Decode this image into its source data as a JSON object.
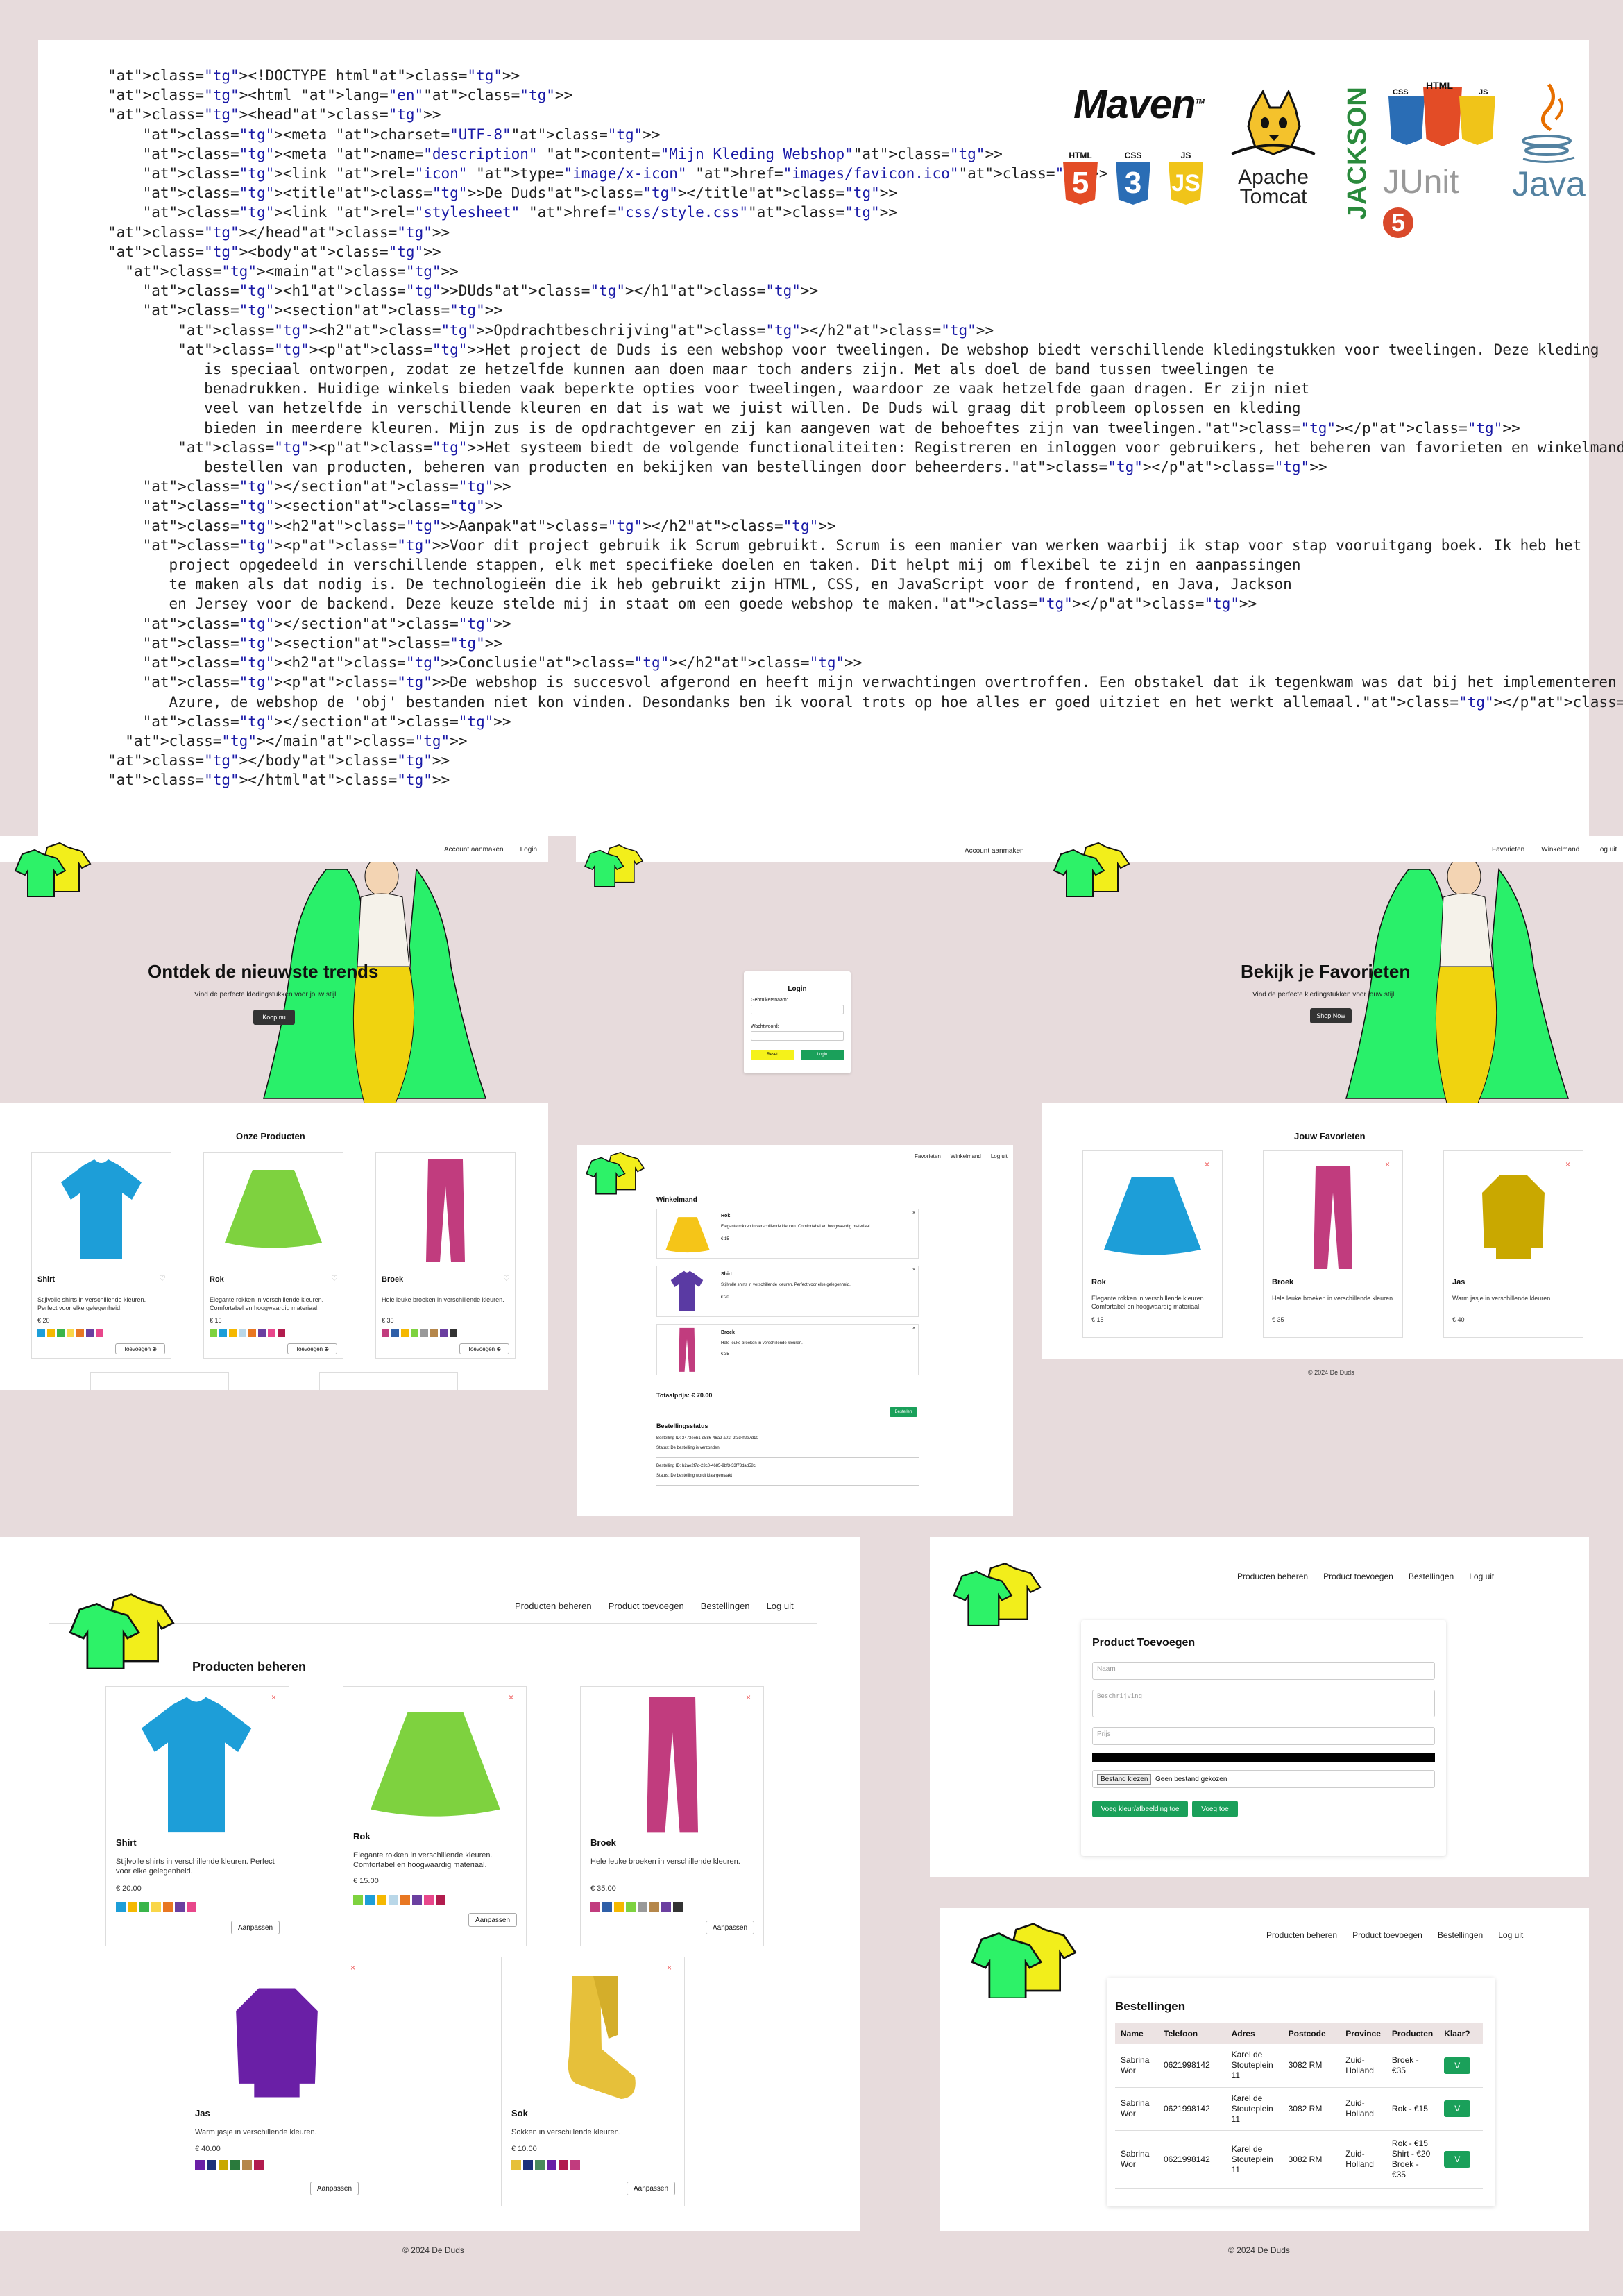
{
  "code": {
    "lines": [
      "<!DOCTYPE html>",
      "<html lang=\"en\">",
      "<head>",
      "    <meta charset=\"UTF-8\">",
      "    <meta name=\"description\" content=\"Mijn Kleding Webshop\">",
      "    <link rel=\"icon\" type=\"image/x-icon\" href=\"images/favicon.ico\">",
      "    <title>De Duds</title>",
      "    <link rel=\"stylesheet\" href=\"css/style.css\">",
      "</head>",
      "<body>",
      "  <main>",
      "    <h1>DUds</h1>",
      "    <section>",
      "        <h2>Opdrachtbeschrijving</h2>",
      "        <p>Het project de Duds is een webshop voor tweelingen. De webshop biedt verschillende kledingstukken voor tweelingen. Deze kleding",
      "           is speciaal ontworpen, zodat ze hetzelfde kunnen aan doen maar toch anders zijn. Met als doel de band tussen tweelingen te",
      "           benadrukken. Huidige winkels bieden vaak beperkte opties voor tweelingen, waardoor ze vaak hetzelfde gaan dragen. Er zijn niet",
      "           veel van hetzelfde in verschillende kleuren en dat is wat we juist willen. De Duds wil graag dit probleem oplossen en kleding",
      "           bieden in meerdere kleuren. Mijn zus is de opdrachtgever en zij kan aangeven wat de behoeftes zijn van tweelingen.</p>",
      "        <p>Het systeem biedt de volgende functionaliteiten: Registreren en inloggen voor gebruikers, het beheren van favorieten en winkelmand,",
      "           bestellen van producten, beheren van producten en bekijken van bestellingen door beheerders.</p>",
      "    </section>",
      "    <section>",
      "    <h2>Aanpak</h2>",
      "    <p>Voor dit project gebruik ik Scrum gebruikt. Scrum is een manier van werken waarbij ik stap voor stap vooruitgang boek. Ik heb het",
      "       project opgedeeld in verschillende stappen, elk met specifieke doelen en taken. Dit helpt mij om flexibel te zijn en aanpassingen",
      "       te maken als dat nodig is. De technologieën die ik heb gebruikt zijn HTML, CSS, en JavaScript voor de frontend, en Java, Jackson",
      "       en Jersey voor de backend. Deze keuze stelde mij in staat om een goede webshop te maken.</p>",
      "    </section>",
      "    <section>",
      "    <h2>Conclusie</h2>",
      "    <p>De webshop is succesvol afgerond en heeft mijn verwachtingen overtroffen. Een obstakel dat ik tegenkwam was dat bij het implementeren op",
      "       Azure, de webshop de 'obj' bestanden niet kon vinden. Desondanks ben ik vooral trots op hoe alles er goed uitziet en het werkt allemaal.</p>",
      "    </section>",
      "  </main>",
      "</body>",
      "</html>"
    ]
  },
  "logos": {
    "maven": "Maven",
    "maven_tm": "TM",
    "tomcat_line1": "Apache",
    "tomcat_line2": "Tomcat",
    "jackson": "JACKSON",
    "junit": "JUnit",
    "junit_num": "5",
    "java": "Java",
    "html": "HTML",
    "css": "CSS",
    "js": "JS",
    "html_num": "5",
    "css_num": "3",
    "js_num": "JS"
  },
  "shop_home": {
    "nav": [
      "Account aanmaken",
      "Login"
    ],
    "hero_title": "Ontdek de nieuwste trends",
    "hero_sub": "Vind de perfecte kledingstukken voor jouw stijl",
    "hero_button": "Koop nu",
    "products_title": "Onze Producten",
    "products": [
      {
        "name": "Shirt",
        "desc": "Stijlvolle shirts in verschillende kleuren. Perfect voor elke gelegenheid.",
        "price": "€ 20",
        "button": "Toevoegen"
      },
      {
        "name": "Rok",
        "desc": "Elegante rokken in verschillende kleuren. Comfortabel en hoogwaardig materiaal.",
        "price": "€ 15",
        "button": "Toevoegen"
      },
      {
        "name": "Broek",
        "desc": "Hele leuke broeken in verschillende kleuren.",
        "price": "€ 35",
        "button": "Toevoegen"
      }
    ]
  },
  "login": {
    "nav": [
      "Account aanmaken"
    ],
    "title": "Login",
    "user_label": "Gebruikersnaam:",
    "pass_label": "Wachtwoord:",
    "reset": "Reset",
    "submit": "Login"
  },
  "favorites_page": {
    "nav": [
      "Favorieten",
      "Winkelmand",
      "Log uit"
    ],
    "hero_title": "Bekijk je Favorieten",
    "hero_sub": "Vind de perfecte kledingstukken voor jouw stijl",
    "hero_button": "Shop Now",
    "section_title": "Jouw Favorieten",
    "items": [
      {
        "name": "Rok",
        "desc": "Elegante rokken in verschillende kleuren. Comfortabel en hoogwaardig materiaal.",
        "price": "€ 15"
      },
      {
        "name": "Broek",
        "desc": "Hele leuke broeken in verschillende kleuren.",
        "price": "€ 35"
      },
      {
        "name": "Jas",
        "desc": "Warm jasje in verschillende kleuren.",
        "price": "€ 40"
      }
    ],
    "footer": "© 2024 De Duds"
  },
  "cart": {
    "nav": [
      "Favorieten",
      "Winkelmand",
      "Log uit"
    ],
    "title": "Winkelmand",
    "items": [
      {
        "name": "Rok",
        "desc": "Elegante rokken in verschillende kleuren. Comfortabel en hoogwaardig materiaal.",
        "price": "€ 15"
      },
      {
        "name": "Shirt",
        "desc": "Stijlvolle shirts in verschillende kleuren. Perfect voor elke gelegenheid.",
        "price": "€ 20"
      },
      {
        "name": "Broek",
        "desc": "Hele leuke broeken in verschillende kleuren.",
        "price": "€ 35"
      }
    ],
    "total": "Totaalprijs: € 70.00",
    "order_button": "Bestellen",
    "status_title": "Bestellingsstatus",
    "orders": [
      {
        "id": "Bestelling ID: 2473eeb1-d586-46a2-a01f-2f3d4f2e7d10",
        "status": "Status: De bestelling is verzonden"
      },
      {
        "id": "Bestelling ID: b2ae2f7d-23c0-4685-9bf3-33f73dad58c",
        "status": "Status: De bestelling wordt klaargemaakt"
      }
    ]
  },
  "admin_products": {
    "nav": [
      "Producten beheren",
      "Product toevoegen",
      "Bestellingen",
      "Log uit"
    ],
    "title": "Producten beheren",
    "products": [
      {
        "name": "Shirt",
        "desc": "Stijlvolle shirts in verschillende kleuren. Perfect voor elke gelegenheid.",
        "price": "€ 20.00"
      },
      {
        "name": "Rok",
        "desc": "Elegante rokken in verschillende kleuren. Comfortabel en hoogwaardig materiaal.",
        "price": "€ 15.00"
      },
      {
        "name": "Broek",
        "desc": "Hele leuke broeken in verschillende kleuren.",
        "price": "€ 35.00"
      },
      {
        "name": "Jas",
        "desc": "Warm jasje in verschillende kleuren.",
        "price": "€ 40.00"
      },
      {
        "name": "Sok",
        "desc": "Sokken in verschillende kleuren.",
        "price": "€ 10.00"
      }
    ],
    "edit_button": "Aanpassen",
    "footer": "© 2024 De Duds"
  },
  "admin_add": {
    "nav": [
      "Producten beheren",
      "Product toevoegen",
      "Bestellingen",
      "Log uit"
    ],
    "title": "Product Toevoegen",
    "name_ph": "Naam",
    "desc_ph": "Beschrijving",
    "price_ph": "Prijs",
    "file_button": "Bestand kiezen",
    "file_text": "Geen bestand gekozen",
    "add_color": "Voeg kleur/afbeelding toe",
    "add": "Voeg toe"
  },
  "admin_orders": {
    "nav": [
      "Producten beheren",
      "Product toevoegen",
      "Bestellingen",
      "Log uit"
    ],
    "title": "Bestellingen",
    "headers": [
      "Name",
      "Telefoon",
      "Adres",
      "Postcode",
      "Province",
      "Producten",
      "Klaar?"
    ],
    "rows": [
      [
        "Sabrina Wor",
        "0621998142",
        "Karel de Stouteplein 11",
        "3082 RM",
        "Zuid-Holland",
        "Broek - €35"
      ],
      [
        "Sabrina Wor",
        "0621998142",
        "Karel de Stouteplein 11",
        "3082 RM",
        "Zuid-Holland",
        "Rok - €15"
      ],
      [
        "Sabrina Wor",
        "0621998142",
        "Karel de Stouteplein 11",
        "3082 RM",
        "Zuid-Holland",
        "Rok - €15 Shirt - €20 Broek - €35"
      ]
    ],
    "done_button": "V",
    "footer": "© 2024 De Duds"
  }
}
